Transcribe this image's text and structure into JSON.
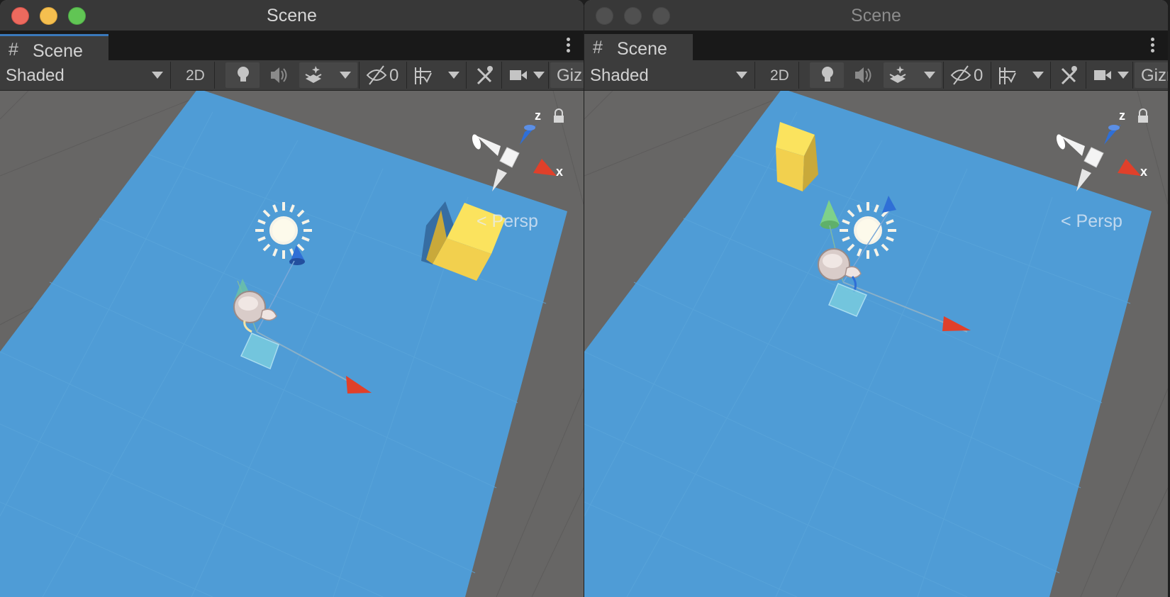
{
  "windows": [
    {
      "id": "left",
      "title": "Scene",
      "active": true,
      "tab_label": "Scene",
      "toolbar": {
        "shading_mode": "Shaded",
        "mode_2d_label": "2D",
        "hidden_count": "0",
        "gizmos_label": "Giz"
      },
      "viewport": {
        "projection_label": "Persp",
        "gizmo_axis_labels": {
          "z": "z",
          "x": "x"
        }
      }
    },
    {
      "id": "right",
      "title": "Scene",
      "active": false,
      "tab_label": "Scene",
      "toolbar": {
        "shading_mode": "Shaded",
        "mode_2d_label": "2D",
        "hidden_count": "0",
        "gizmos_label": "Gizm"
      },
      "viewport": {
        "projection_label": "Persp",
        "gizmo_axis_labels": {
          "z": "z",
          "x": "x"
        }
      }
    }
  ],
  "colors": {
    "ground_plane": "#4f9cd6",
    "background": "#666666",
    "cube_yellow": "#f2d04e",
    "axis_x": "#e0402a",
    "axis_y": "#7ed18a",
    "axis_z": "#2f6fd6",
    "tab_accent": "#3a79bb"
  },
  "icons": [
    "grid-hash-icon",
    "kebab-menu-icon",
    "dropdown-arrow-icon",
    "lightbulb-icon",
    "audio-icon",
    "effects-icon",
    "visibility-icon",
    "grid-snap-icon",
    "tools-icon",
    "camera-icon",
    "lock-icon",
    "directional-light-icon",
    "character-icon",
    "orientation-gizmo"
  ]
}
